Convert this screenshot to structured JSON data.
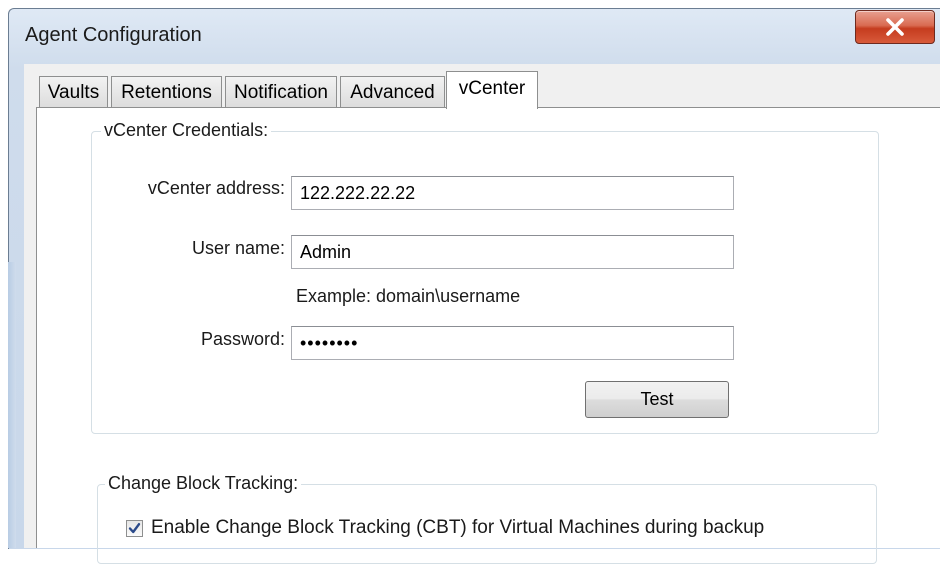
{
  "window": {
    "title": "Agent Configuration",
    "close_icon": "close-x-icon",
    "accent_color": "#c53c1f"
  },
  "tabs": [
    {
      "label": "Vaults",
      "active": false
    },
    {
      "label": "Retentions",
      "active": false
    },
    {
      "label": "Notification",
      "active": false
    },
    {
      "label": "Advanced",
      "active": false
    },
    {
      "label": "vCenter",
      "active": true
    }
  ],
  "credentials": {
    "group_label": "vCenter Credentials:",
    "address_label": "vCenter address:",
    "address_value": "122.222.22.22",
    "username_label": "User name:",
    "username_value": "Admin",
    "username_hint": "Example:  domain\\username",
    "password_label": "Password:",
    "password_value": "••••••••",
    "test_button": "Test"
  },
  "cbt": {
    "group_label": "Change Block Tracking:",
    "enable_label": "Enable Change Block Tracking (CBT) for Virtual Machines during backup",
    "enable_checked": true
  }
}
